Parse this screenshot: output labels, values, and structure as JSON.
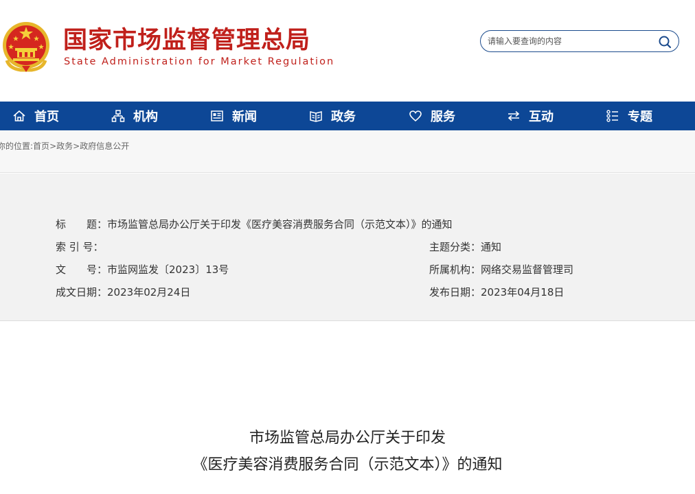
{
  "header": {
    "title_cn": "国家市场监督管理总局",
    "title_en": "State Administration for Market Regulation",
    "search_placeholder": "请输入要查询的内容"
  },
  "nav": {
    "items": [
      {
        "label": "首页",
        "icon": "home-icon"
      },
      {
        "label": "机构",
        "icon": "org-chart-icon"
      },
      {
        "label": "新闻",
        "icon": "news-icon"
      },
      {
        "label": "政务",
        "icon": "gov-book-icon"
      },
      {
        "label": "服务",
        "icon": "heart-icon"
      },
      {
        "label": "互动",
        "icon": "exchange-arrows-icon"
      },
      {
        "label": "专题",
        "icon": "topics-grid-icon"
      }
    ]
  },
  "breadcrumb": {
    "prefix": "你的位置:",
    "links": [
      "首页",
      "政务",
      "政府信息公开"
    ],
    "separator": ">"
  },
  "info": {
    "title_label": "标　　题：",
    "title_value": "市场监管总局办公厅关于印发《医疗美容消费服务合同（示范文本）》的通知",
    "index_label": "索 引 号：",
    "index_value": "",
    "topic_label": "主题分类：",
    "topic_value": "通知",
    "docno_label": "文　　号：",
    "docno_value": "市监网监发〔2023〕13号",
    "org_label": "所属机构：",
    "org_value": "网络交易监督管理司",
    "created_label": "成文日期：",
    "created_value": "2023年02月24日",
    "published_label": "发布日期：",
    "published_value": "2023年04月18日"
  },
  "document": {
    "title_line1": "市场监管总局办公厅关于印发",
    "title_line2": "《医疗美容消费服务合同（示范文本）》的通知"
  },
  "colors": {
    "brand_red": "#c0201b",
    "nav_blue": "#0d4796"
  }
}
